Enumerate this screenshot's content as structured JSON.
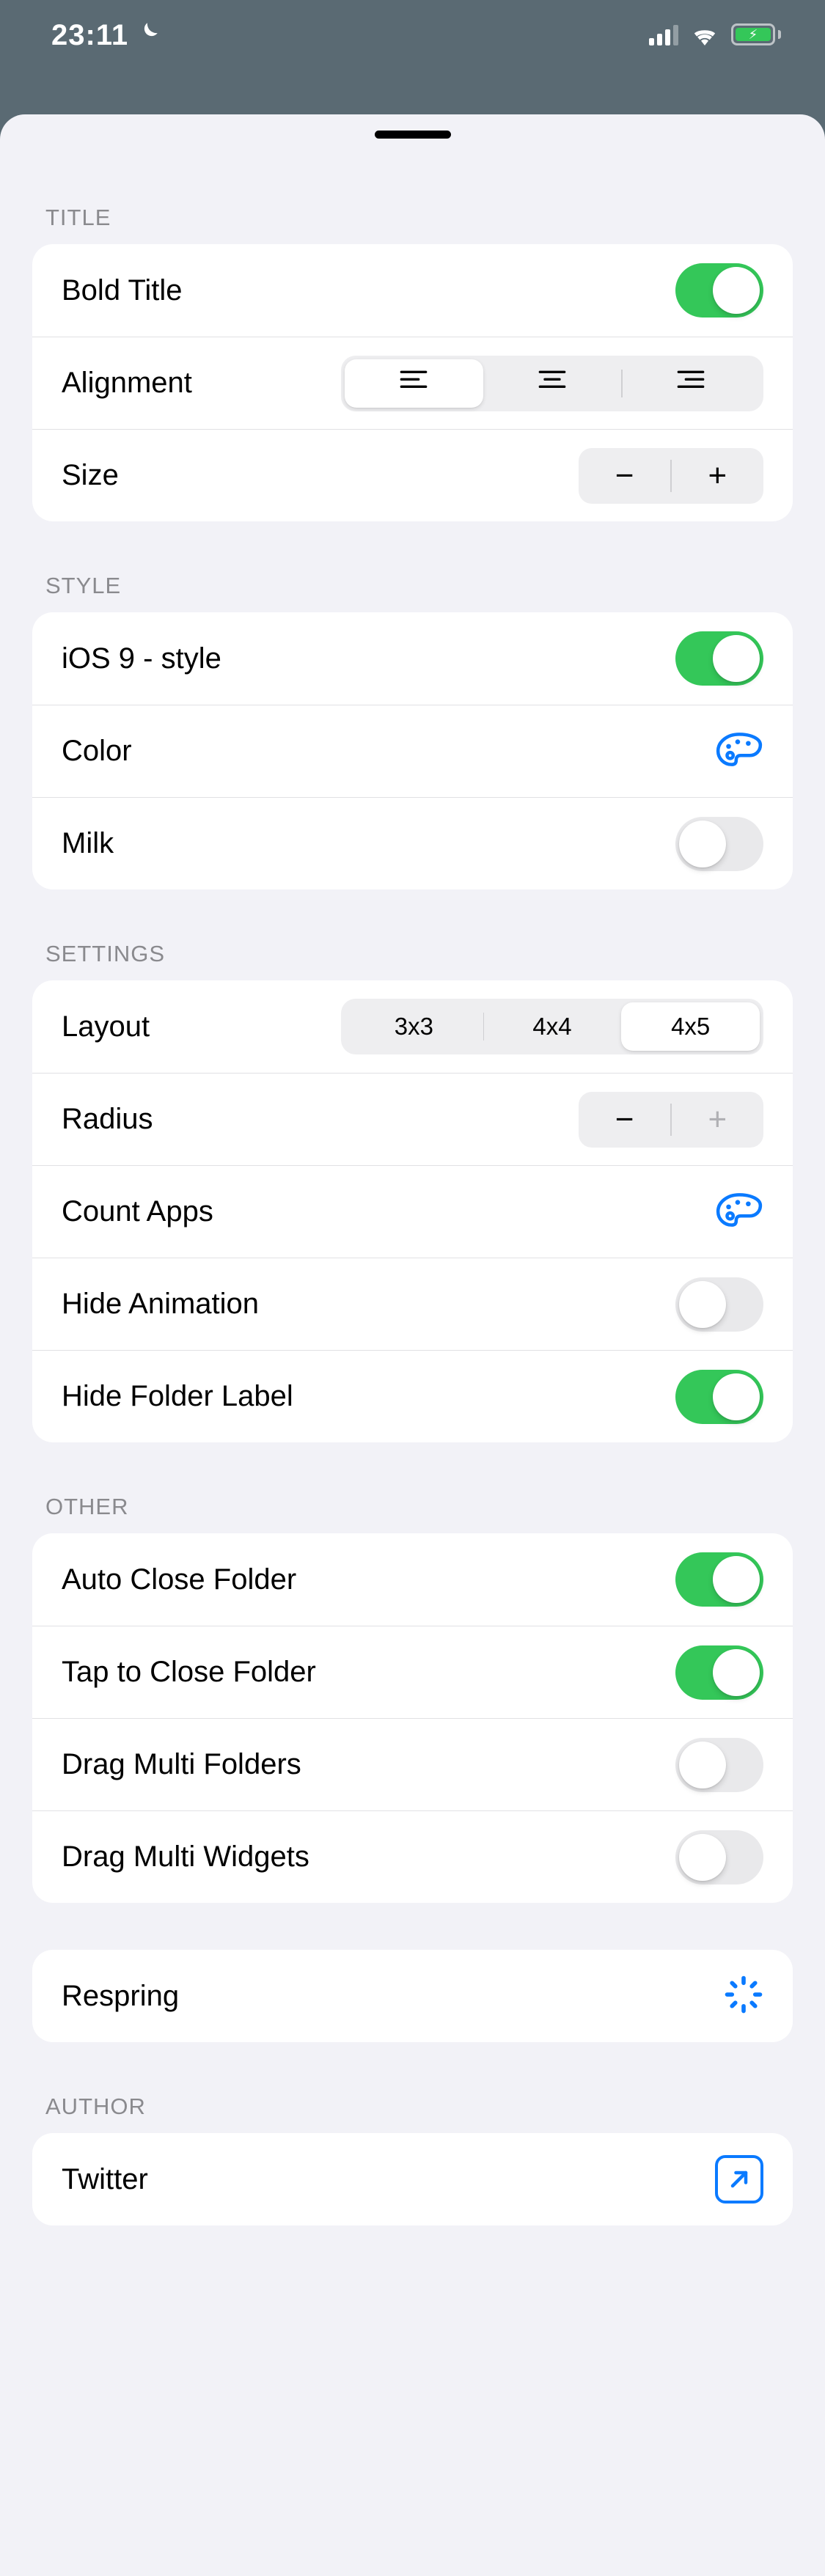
{
  "status": {
    "time": "23:11"
  },
  "sections": {
    "title": {
      "header": "TITLE",
      "bold_title": "Bold Title",
      "bold_title_on": true,
      "alignment": "Alignment",
      "size": "Size"
    },
    "style": {
      "header": "STYLE",
      "ios9": "iOS 9 - style",
      "ios9_on": true,
      "color": "Color",
      "milk": "Milk",
      "milk_on": false
    },
    "settings": {
      "header": "SETTINGS",
      "layout": "Layout",
      "layout_options": {
        "a": "3x3",
        "b": "4x4",
        "c": "4x5"
      },
      "radius": "Radius",
      "count_apps": "Count Apps",
      "hide_animation": "Hide Animation",
      "hide_animation_on": false,
      "hide_folder_label": "Hide Folder Label",
      "hide_folder_label_on": true
    },
    "other": {
      "header": "OTHER",
      "auto_close": "Auto Close Folder",
      "auto_close_on": true,
      "tap_close": "Tap to Close Folder",
      "tap_close_on": true,
      "drag_folders": "Drag Multi Folders",
      "drag_folders_on": false,
      "drag_widgets": "Drag Multi Widgets",
      "drag_widgets_on": false
    },
    "respring": {
      "label": "Respring"
    },
    "author": {
      "header": "AUTHOR",
      "twitter": "Twitter"
    }
  }
}
